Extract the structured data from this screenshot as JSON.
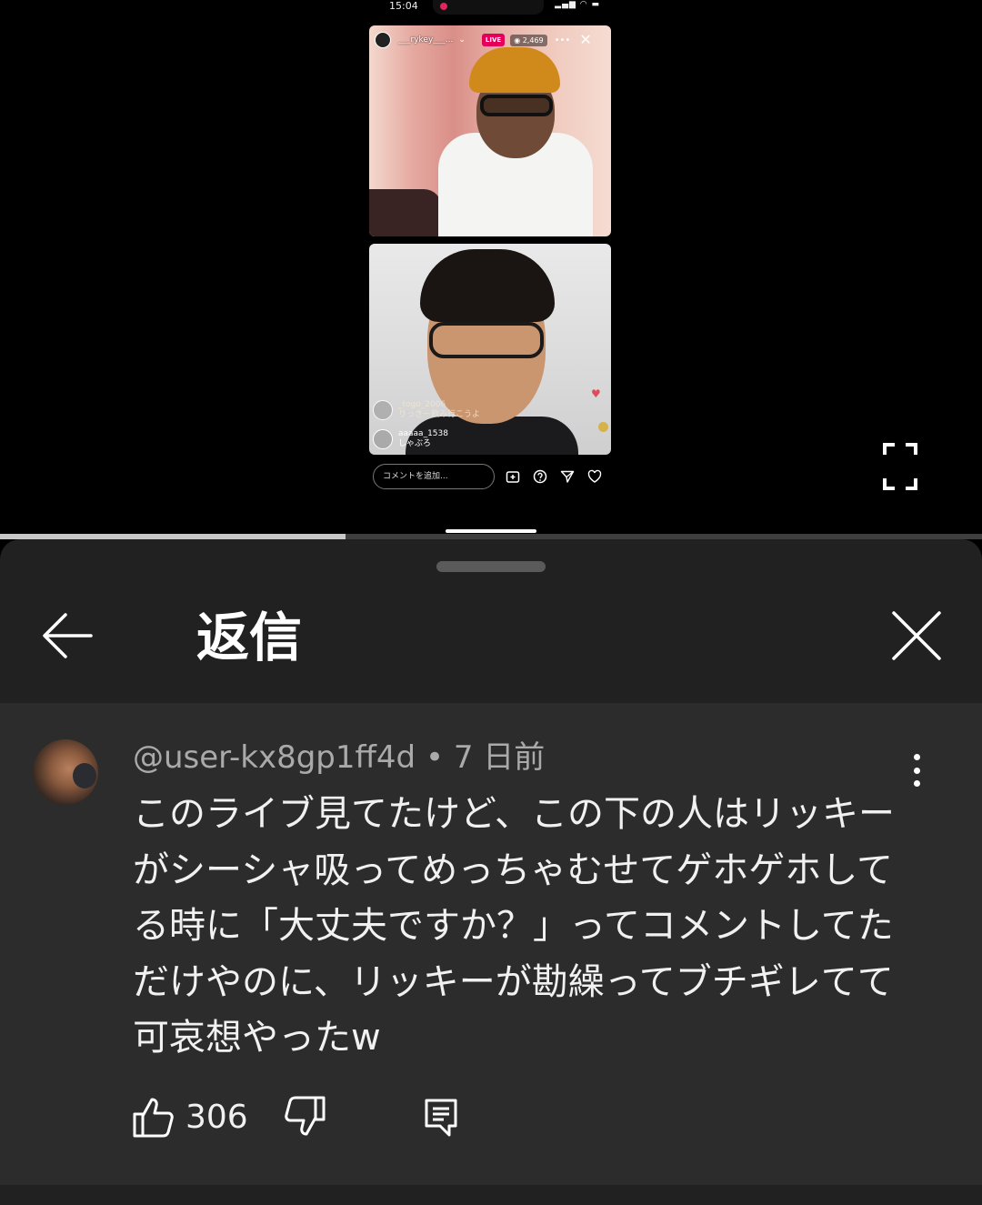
{
  "status_bar": {
    "time": "15:04"
  },
  "instagram_live": {
    "username": "___rykey___...",
    "live_badge": "LIVE",
    "viewer_count": "2,469",
    "comments": [
      {
        "user": "_togo_2006",
        "text": "りっきー飲み行こうよ"
      },
      {
        "user": "aaaaa_1538",
        "text": "しゃぶろ"
      }
    ],
    "comment_placeholder": "コメントを追加..."
  },
  "player": {
    "progress_fraction": 0.352
  },
  "panel": {
    "title": "返信"
  },
  "comment": {
    "author": "@user-kx8gp1ff4d",
    "separator": " • ",
    "time_ago": "7 日前",
    "text": "このライブ見てたけど、この下の人はリッキーがシーシャ吸ってめっちゃむせてゲホゲホしてる時に「大丈夫ですか？」ってコメントしてただけやのに、リッキーが勘繰ってブチギレてて可哀想やったw",
    "like_count": "306"
  },
  "colors": {
    "panel_bg": "#212121",
    "comment_bg": "#2c2c2c",
    "live_red": "#e4005a",
    "meta_text": "#aaaaaa"
  }
}
